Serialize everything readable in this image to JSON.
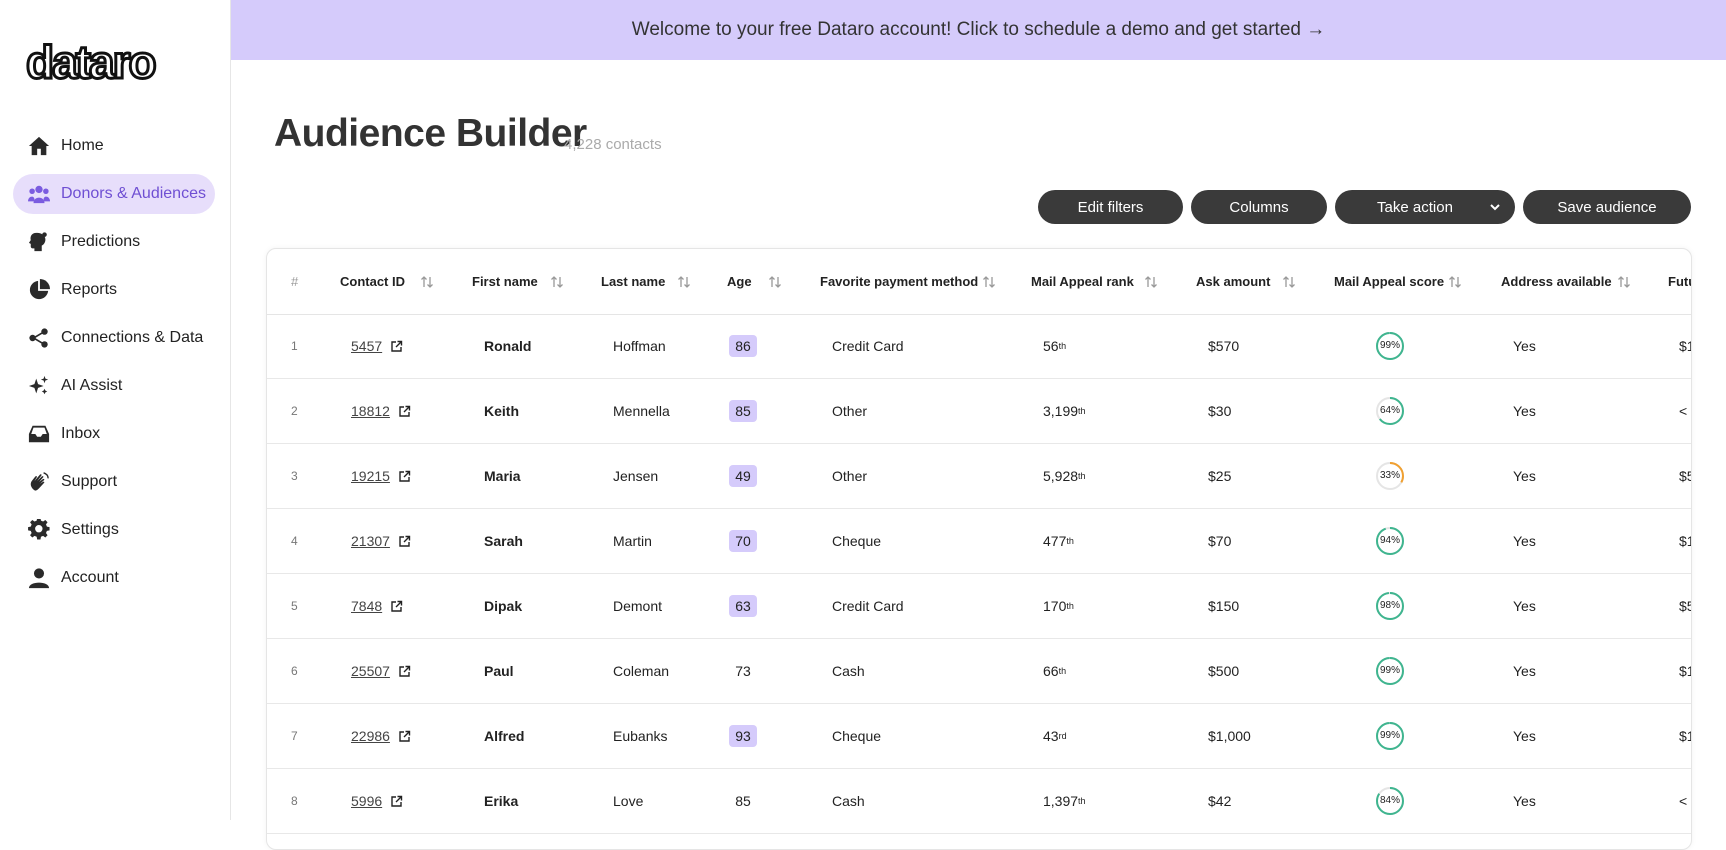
{
  "banner": {
    "text": "Welcome to your free Dataro account! Click to schedule a demo and get started →"
  },
  "logo": {
    "text": "dataro"
  },
  "sidebar": {
    "items": [
      {
        "label": "Home",
        "icon": "home-icon",
        "active": false
      },
      {
        "label": "Donors & Audiences",
        "icon": "people-icon",
        "active": true
      },
      {
        "label": "Predictions",
        "icon": "predictions-icon",
        "active": false
      },
      {
        "label": "Reports",
        "icon": "pie-chart-icon",
        "active": false
      },
      {
        "label": "Connections & Data",
        "icon": "share-icon",
        "active": false
      },
      {
        "label": "AI Assist",
        "icon": "sparkle-icon",
        "active": false
      },
      {
        "label": "Inbox",
        "icon": "inbox-icon",
        "active": false
      },
      {
        "label": "Support",
        "icon": "hand-wave-icon",
        "active": false
      },
      {
        "label": "Settings",
        "icon": "gear-icon",
        "active": false
      },
      {
        "label": "Account",
        "icon": "user-icon",
        "active": false
      }
    ]
  },
  "page": {
    "title": "Audience Builder",
    "count": "4,228 contacts"
  },
  "toolbar": {
    "edit_filters": "Edit filters",
    "columns": "Columns",
    "take_action": "Take action",
    "save_audience": "Save audience"
  },
  "table": {
    "headers": [
      "#",
      "Contact ID",
      "First name",
      "Last name",
      "Age",
      "Favorite payment method",
      "Mail Appeal rank",
      "Ask amount",
      "Mail Appeal score",
      "Address available",
      "Futu"
    ],
    "rows": [
      {
        "idx": "1",
        "cid": "5457",
        "first": "Ronald",
        "last": "Hoffman",
        "age": "86",
        "age_hl": true,
        "pay": "Credit Card",
        "rank": "56",
        "rank_sfx": "th",
        "ask": "$570",
        "score": "99%",
        "score_val": 99,
        "score_color": "#3fb58f",
        "addr": "Yes",
        "fut": "$1"
      },
      {
        "idx": "2",
        "cid": "18812",
        "first": "Keith",
        "last": "Mennella",
        "age": "85",
        "age_hl": true,
        "pay": "Other",
        "rank": "3,199",
        "rank_sfx": "th",
        "ask": "$30",
        "score": "64%",
        "score_val": 64,
        "score_color": "#3fb58f",
        "addr": "Yes",
        "fut": "< $"
      },
      {
        "idx": "3",
        "cid": "19215",
        "first": "Maria",
        "last": "Jensen",
        "age": "49",
        "age_hl": true,
        "pay": "Other",
        "rank": "5,928",
        "rank_sfx": "th",
        "ask": "$25",
        "score": "33%",
        "score_val": 33,
        "score_color": "#f0a030",
        "addr": "Yes",
        "fut": "$5"
      },
      {
        "idx": "4",
        "cid": "21307",
        "first": "Sarah",
        "last": "Martin",
        "age": "70",
        "age_hl": true,
        "pay": "Cheque",
        "rank": "477",
        "rank_sfx": "th",
        "ask": "$70",
        "score": "94%",
        "score_val": 94,
        "score_color": "#3fb58f",
        "addr": "Yes",
        "fut": "$1"
      },
      {
        "idx": "5",
        "cid": "7848",
        "first": "Dipak",
        "last": "Demont",
        "age": "63",
        "age_hl": true,
        "pay": "Credit Card",
        "rank": "170",
        "rank_sfx": "th",
        "ask": "$150",
        "score": "98%",
        "score_val": 98,
        "score_color": "#3fb58f",
        "addr": "Yes",
        "fut": "$5"
      },
      {
        "idx": "6",
        "cid": "25507",
        "first": "Paul",
        "last": "Coleman",
        "age": "73",
        "age_hl": false,
        "pay": "Cash",
        "rank": "66",
        "rank_sfx": "th",
        "ask": "$500",
        "score": "99%",
        "score_val": 99,
        "score_color": "#3fb58f",
        "addr": "Yes",
        "fut": "$1"
      },
      {
        "idx": "7",
        "cid": "22986",
        "first": "Alfred",
        "last": "Eubanks",
        "age": "93",
        "age_hl": true,
        "pay": "Cheque",
        "rank": "43",
        "rank_sfx": "rd",
        "ask": "$1,000",
        "score": "99%",
        "score_val": 99,
        "score_color": "#3fb58f",
        "addr": "Yes",
        "fut": "$1"
      },
      {
        "idx": "8",
        "cid": "5996",
        "first": "Erika",
        "last": "Love",
        "age": "85",
        "age_hl": false,
        "pay": "Cash",
        "rank": "1,397",
        "rank_sfx": "th",
        "ask": "$42",
        "score": "84%",
        "score_val": 84,
        "score_color": "#3fb58f",
        "addr": "Yes",
        "fut": "< $"
      }
    ]
  }
}
